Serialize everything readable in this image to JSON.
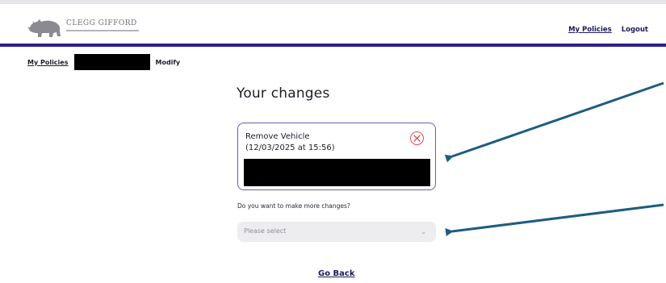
{
  "header": {
    "brand": "CLEGG GIFFORD",
    "nav": {
      "my_policies": "My Policies",
      "logout": "Logout"
    }
  },
  "breadcrumb": {
    "my_policies": "My Policies",
    "current": "Modify"
  },
  "main": {
    "title": "Your changes",
    "change": {
      "name": "Remove Vehicle",
      "date": "(12/03/2025 at 15:56)"
    },
    "question": "Do you want to make more changes?",
    "select": {
      "value": "Please select"
    },
    "go_back": "Go Back"
  },
  "colors": {
    "header_rule": "#2e1f8f",
    "card_border": "#6c5ba8",
    "remove_icon": "#e04a5a",
    "arrow": "#1f5c80"
  }
}
